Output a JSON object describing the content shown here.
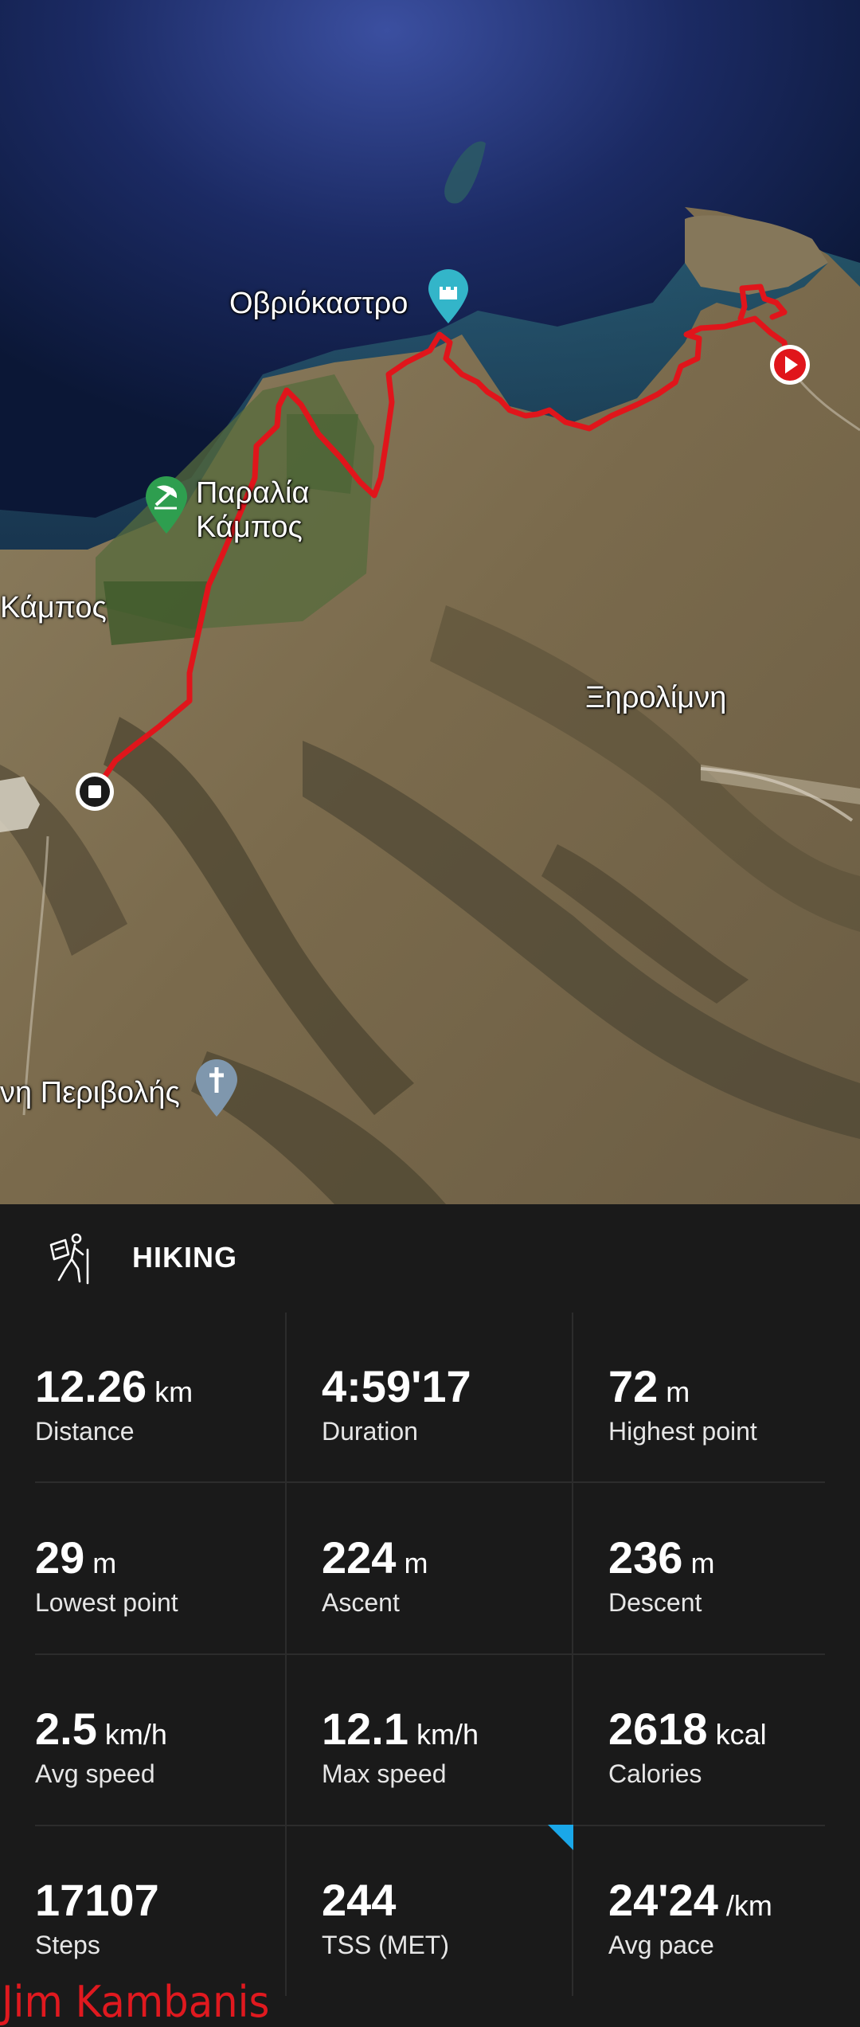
{
  "map": {
    "labels": {
      "obriokastro": "Οβριόκαστρο",
      "paralia_line1": "Παραλία",
      "paralia_line2": "Κάμπος",
      "kampos": "Κάμπος",
      "xirolimni": "Ξηρολίμνη",
      "perivolis": "νη Περιβολής"
    },
    "icons": {
      "castle_pin": "castle-pin-icon",
      "beach_pin": "beach-pin-icon",
      "church_pin": "church-pin-icon",
      "start_marker": "play-icon",
      "end_marker": "stop-icon"
    },
    "colors": {
      "route": "#e0151b",
      "sea_deep": "#0d1b3e",
      "land": "#8b7a5a",
      "castle_pin": "#33b5c9",
      "beach_pin": "#2e9e4f",
      "church_pin": "#7f97ad"
    }
  },
  "activity": {
    "icon": "hiking-icon",
    "label": "HIKING"
  },
  "stats": [
    {
      "value": "12.26",
      "unit": "km",
      "label": "Distance"
    },
    {
      "value": "4:59'17",
      "unit": "",
      "label": "Duration"
    },
    {
      "value": "72",
      "unit": "m",
      "label": "Highest point"
    },
    {
      "value": "29",
      "unit": "m",
      "label": "Lowest point"
    },
    {
      "value": "224",
      "unit": "m",
      "label": "Ascent"
    },
    {
      "value": "236",
      "unit": "m",
      "label": "Descent"
    },
    {
      "value": "2.5",
      "unit": "km/h",
      "label": "Avg speed"
    },
    {
      "value": "12.1",
      "unit": "km/h",
      "label": "Max speed"
    },
    {
      "value": "2618",
      "unit": "kcal",
      "label": "Calories"
    },
    {
      "value": "17107",
      "unit": "",
      "label": "Steps"
    },
    {
      "value": "244",
      "unit": "",
      "label": "TSS (MET)"
    },
    {
      "value": "24'24",
      "unit": "/km",
      "label": "Avg pace"
    }
  ],
  "colors": {
    "panel_bg": "#1a1a1a",
    "divider": "#2c2c2c",
    "accent_flag": "#1aa7e8",
    "watermark": "#e0191f"
  },
  "watermark": "Jim Kambanis"
}
